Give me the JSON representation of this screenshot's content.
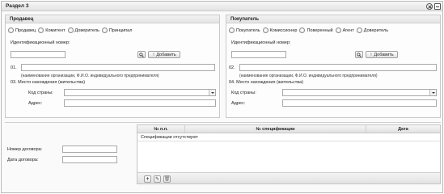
{
  "window": {
    "title": "Раздел 3"
  },
  "seller": {
    "heading": "Продавец",
    "radios": [
      "Продавец",
      "Комитент",
      "Доверитель",
      "Принципал"
    ],
    "id_label": "Идентификационный номер:",
    "add_label": "Добавить",
    "num": "01.",
    "hint": "(наименование организации, Ф.И.О. индивидуального предпринимателя)",
    "location_label": "03.  Место нахождения (жительства)",
    "country_label": "Код страны:",
    "address_label": "Адрес:"
  },
  "buyer": {
    "heading": "Покупатель",
    "radios": [
      "Покупатель",
      "Комиссионер",
      "Поверенный",
      "Агент",
      "Доверитель"
    ],
    "id_label": "Идентификационный номер:",
    "add_label": "Добавить",
    "num": "02.",
    "hint": "(наименование организации, Ф.И.О. индивидуального предпринимателя)",
    "location_label": "04.  Место нахождения (жительства)",
    "country_label": "Код страны:",
    "address_label": "Адрес:"
  },
  "contract": {
    "number_label": "Номер договора:",
    "date_label": "Дата договора:"
  },
  "specs": {
    "columns": [
      "№ п.п.",
      "№ спецификации",
      "Дата"
    ],
    "empty_text": "Спецификации отсутствуют"
  }
}
